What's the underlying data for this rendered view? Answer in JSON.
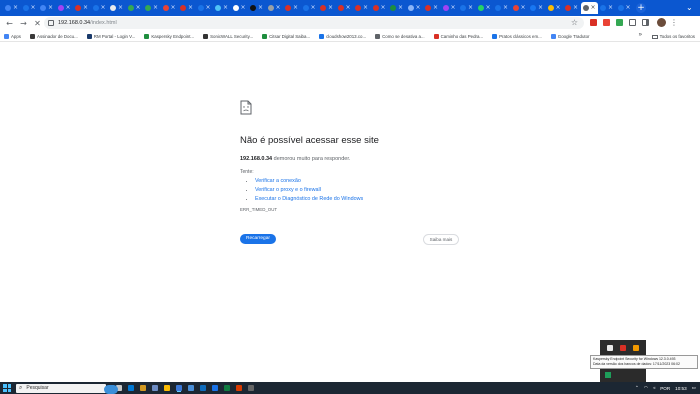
{
  "browser": {
    "tabs": [
      {
        "color": "#4285f4"
      },
      {
        "color": "#1a73e8"
      },
      {
        "color": "#4285f4"
      },
      {
        "color": "#a142f4"
      },
      {
        "color": "#d93025"
      },
      {
        "color": "#1a73e8"
      },
      {
        "color": "#e8eaed"
      },
      {
        "color": "#34a853"
      },
      {
        "color": "#34a853"
      },
      {
        "color": "#ea4335"
      },
      {
        "color": "#d93025"
      },
      {
        "color": "#1a73e8"
      },
      {
        "color": "#4fc3f7"
      },
      {
        "color": "#ffffff"
      },
      {
        "color": "#111111"
      },
      {
        "color": "#9aa0a6"
      },
      {
        "color": "#d93025"
      },
      {
        "color": "#1a73e8"
      },
      {
        "color": "#d93025"
      },
      {
        "color": "#d93025"
      },
      {
        "color": "#d93025"
      },
      {
        "color": "#d93025"
      },
      {
        "color": "#1e8e3e"
      },
      {
        "color": "#8ab4f8"
      },
      {
        "color": "#d93025"
      },
      {
        "color": "#a142f4"
      },
      {
        "color": "#1a73e8"
      },
      {
        "color": "#25d366"
      },
      {
        "color": "#1a73e8"
      },
      {
        "color": "#ea4335"
      },
      {
        "color": "#1877f2"
      },
      {
        "color": "#fbbc04"
      },
      {
        "color": "#d93025"
      },
      {
        "color": "#ffffff",
        "active": true
      },
      {
        "color": "#1a73e8"
      },
      {
        "color": "#1a73e8"
      }
    ],
    "new_tab_icon": "plus-icon",
    "url_host": "192.168.0.34",
    "url_path": "/index.html",
    "bookmarks": [
      {
        "label": "Apps",
        "color": "#4285f4"
      },
      {
        "label": "Assinador de Docu...",
        "color": "#3a3a3a"
      },
      {
        "label": "RM Portal - Login V...",
        "color": "#1a3a6b"
      },
      {
        "label": "Kaspersky Endpoint...",
        "color": "#1e8e3e"
      },
      {
        "label": "SonicWALL Security...",
        "color": "#333333"
      },
      {
        "label": "Citsar Digital Saiba...",
        "color": "#1e8e3e"
      },
      {
        "label": "cloudshow2013.co...",
        "color": "#1a73e8"
      },
      {
        "label": "Como se desativa a...",
        "color": "#5f6368"
      },
      {
        "label": "Caminho das Pedra...",
        "color": "#d93025"
      },
      {
        "label": "Pratos clássicos em...",
        "color": "#1a73e8"
      },
      {
        "label": "Google Tradutor",
        "color": "#4285f4"
      }
    ],
    "bookmarks_folder": "Todos os favoritos"
  },
  "error": {
    "title": "Não é possível acessar esse site",
    "host": "192.168.0.34",
    "message": " demorou muito para responder.",
    "try_label": "Tente:",
    "suggestions": [
      "Verificar a conexão",
      "Verificar o proxy e o firewall",
      "Executar o Diagnóstico de Rede do Windows"
    ],
    "code": "ERR_TIMED_OUT",
    "reload_label": "Recarregar",
    "details_label": "Saiba mais"
  },
  "tray_popup": {
    "tooltip_line1": "Kaspersky Endpoint Security for Windows 12.3.0.493",
    "tooltip_line2": "Data da versão dos bancos de dados: 17/11/2023 06:02"
  },
  "taskbar": {
    "search_placeholder": "Pesquisar",
    "language": "POR",
    "time": "10:53",
    "app_colors": [
      "#c9c9c9",
      "#0078d4",
      "#d29922",
      "#6d8cc4",
      "#fbbc04",
      "#3c78d8",
      "#4a8fd9",
      "#0f6cbd",
      "#1a73e8",
      "#107c41",
      "#d83b01",
      "#666666"
    ]
  }
}
